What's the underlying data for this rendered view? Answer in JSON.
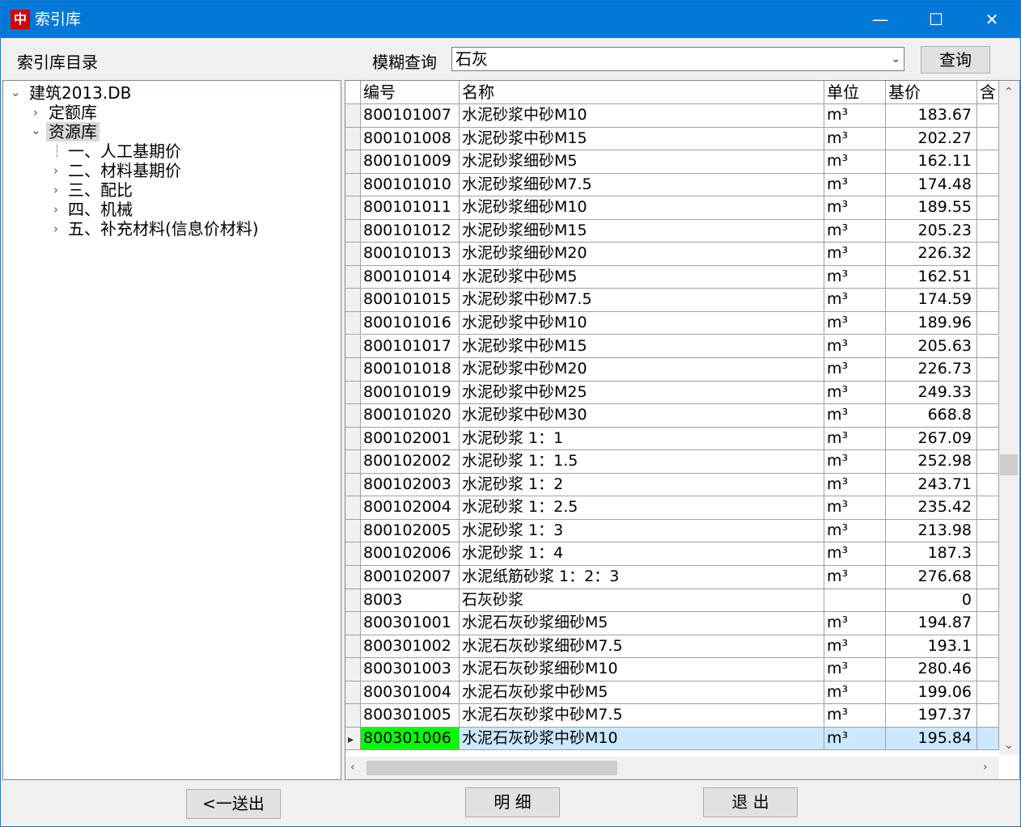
{
  "window": {
    "title": "索引库",
    "icon_glyph": "中",
    "minimize": "—",
    "maximize": "☐",
    "close": "✕"
  },
  "toolbar": {
    "catalog_label": "索引库目录",
    "search_label": "模糊查询",
    "search_value": "石灰",
    "query_button": "查询"
  },
  "tree": {
    "root": "建筑2013.DB",
    "items": [
      {
        "label": "定额库"
      },
      {
        "label": "资源库"
      },
      {
        "label": "一、人工基期价"
      },
      {
        "label": "二、材料基期价"
      },
      {
        "label": "三、配比"
      },
      {
        "label": "四、机械"
      },
      {
        "label": "五、补充材料(信息价材料)"
      }
    ]
  },
  "grid": {
    "columns": [
      "编号",
      "名称",
      "单位",
      "基价",
      "含"
    ],
    "rows": [
      [
        "800101007",
        "水泥砂浆中砂M10",
        "m³",
        "183.67"
      ],
      [
        "800101008",
        "水泥砂浆中砂M15",
        "m³",
        "202.27"
      ],
      [
        "800101009",
        "水泥砂浆细砂M5",
        "m³",
        "162.11"
      ],
      [
        "800101010",
        "水泥砂浆细砂M7.5",
        "m³",
        "174.48"
      ],
      [
        "800101011",
        "水泥砂浆细砂M10",
        "m³",
        "189.55"
      ],
      [
        "800101012",
        "水泥砂浆细砂M15",
        "m³",
        "205.23"
      ],
      [
        "800101013",
        "水泥砂浆细砂M20",
        "m³",
        "226.32"
      ],
      [
        "800101014",
        "水泥砂浆中砂M5",
        "m³",
        "162.51"
      ],
      [
        "800101015",
        "水泥砂浆中砂M7.5",
        "m³",
        "174.59"
      ],
      [
        "800101016",
        "水泥砂浆中砂M10",
        "m³",
        "189.96"
      ],
      [
        "800101017",
        "水泥砂浆中砂M15",
        "m³",
        "205.63"
      ],
      [
        "800101018",
        "水泥砂浆中砂M20",
        "m³",
        "226.73"
      ],
      [
        "800101019",
        "水泥砂浆中砂M25",
        "m³",
        "249.33"
      ],
      [
        "800101020",
        "水泥砂浆中砂M30",
        "m³",
        "668.8"
      ],
      [
        "800102001",
        "水泥砂浆 1：1",
        "m³",
        "267.09"
      ],
      [
        "800102002",
        "水泥砂浆 1：1.5",
        "m³",
        "252.98"
      ],
      [
        "800102003",
        "水泥砂浆 1：2",
        "m³",
        "243.71"
      ],
      [
        "800102004",
        "水泥砂浆 1：2.5",
        "m³",
        "235.42"
      ],
      [
        "800102005",
        "水泥砂浆 1：3",
        "m³",
        "213.98"
      ],
      [
        "800102006",
        "水泥砂浆 1：4",
        "m³",
        "187.3"
      ],
      [
        "800102007",
        "水泥纸筋砂浆 1：2：3",
        "m³",
        "276.68"
      ],
      [
        "8003",
        "石灰砂浆",
        "",
        "0"
      ],
      [
        "800301001",
        "水泥石灰砂浆细砂M5",
        "m³",
        "194.87"
      ],
      [
        "800301002",
        "水泥石灰砂浆细砂M7.5",
        "m³",
        "193.1"
      ],
      [
        "800301003",
        "水泥石灰砂浆细砂M10",
        "m³",
        "280.46"
      ],
      [
        "800301004",
        "水泥石灰砂浆中砂M5",
        "m³",
        "199.06"
      ],
      [
        "800301005",
        "水泥石灰砂浆中砂M7.5",
        "m³",
        "197.37"
      ],
      [
        "800301006",
        "水泥石灰砂浆中砂M10",
        "m³",
        "195.84"
      ]
    ],
    "current_row": 27
  },
  "footer": {
    "send_button": "<一送出",
    "detail_button": "明 细",
    "exit_button": "退 出"
  },
  "colors": {
    "titlebar": "#0078d7",
    "current_code": "#00ff00",
    "current_row": "#cce8ff"
  }
}
